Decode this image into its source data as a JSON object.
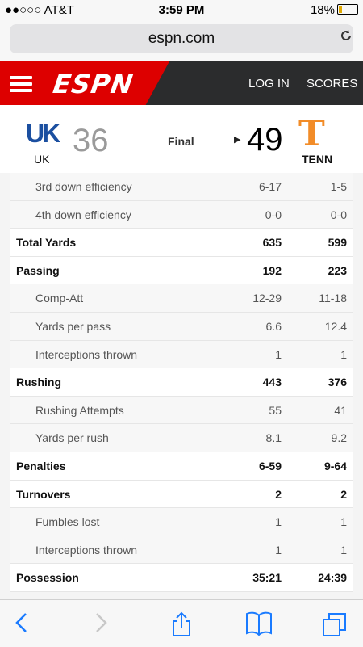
{
  "status": {
    "carrier": "●●○○○ AT&T",
    "time": "3:59 PM",
    "battery": "18%",
    "battery_color": "#e0a800"
  },
  "url": {
    "domain": "espn.com"
  },
  "nav": {
    "logo": "ESPN",
    "login": "LOG IN",
    "scores": "SCORES",
    "brand_color": "#dd0000"
  },
  "score": {
    "away": {
      "logo_text": "UK",
      "abbr": "UK",
      "score": "36",
      "color": "#1b4fa0"
    },
    "status": "Final",
    "home": {
      "logo_text": "T",
      "abbr": "TENN",
      "score": "49",
      "color": "#f28c28"
    }
  },
  "stats": [
    {
      "label": "3rd down efficiency",
      "uk": "6-17",
      "tenn": "1-5",
      "type": "sub"
    },
    {
      "label": "4th down efficiency",
      "uk": "0-0",
      "tenn": "0-0",
      "type": "sub"
    },
    {
      "label": "Total Yards",
      "uk": "635",
      "tenn": "599",
      "type": "head"
    },
    {
      "label": "Passing",
      "uk": "192",
      "tenn": "223",
      "type": "head"
    },
    {
      "label": "Comp-Att",
      "uk": "12-29",
      "tenn": "11-18",
      "type": "sub"
    },
    {
      "label": "Yards per pass",
      "uk": "6.6",
      "tenn": "12.4",
      "type": "sub"
    },
    {
      "label": "Interceptions thrown",
      "uk": "1",
      "tenn": "1",
      "type": "sub"
    },
    {
      "label": "Rushing",
      "uk": "443",
      "tenn": "376",
      "type": "head"
    },
    {
      "label": "Rushing Attempts",
      "uk": "55",
      "tenn": "41",
      "type": "sub"
    },
    {
      "label": "Yards per rush",
      "uk": "8.1",
      "tenn": "9.2",
      "type": "sub"
    },
    {
      "label": "Penalties",
      "uk": "6-59",
      "tenn": "9-64",
      "type": "head"
    },
    {
      "label": "Turnovers",
      "uk": "2",
      "tenn": "2",
      "type": "head"
    },
    {
      "label": "Fumbles lost",
      "uk": "1",
      "tenn": "1",
      "type": "sub"
    },
    {
      "label": "Interceptions thrown",
      "uk": "1",
      "tenn": "1",
      "type": "sub"
    },
    {
      "label": "Possession",
      "uk": "35:21",
      "tenn": "24:39",
      "type": "head"
    }
  ],
  "toolbar": [
    "back-icon",
    "forward-icon",
    "share-icon",
    "bookmarks-icon",
    "tabs-icon"
  ]
}
